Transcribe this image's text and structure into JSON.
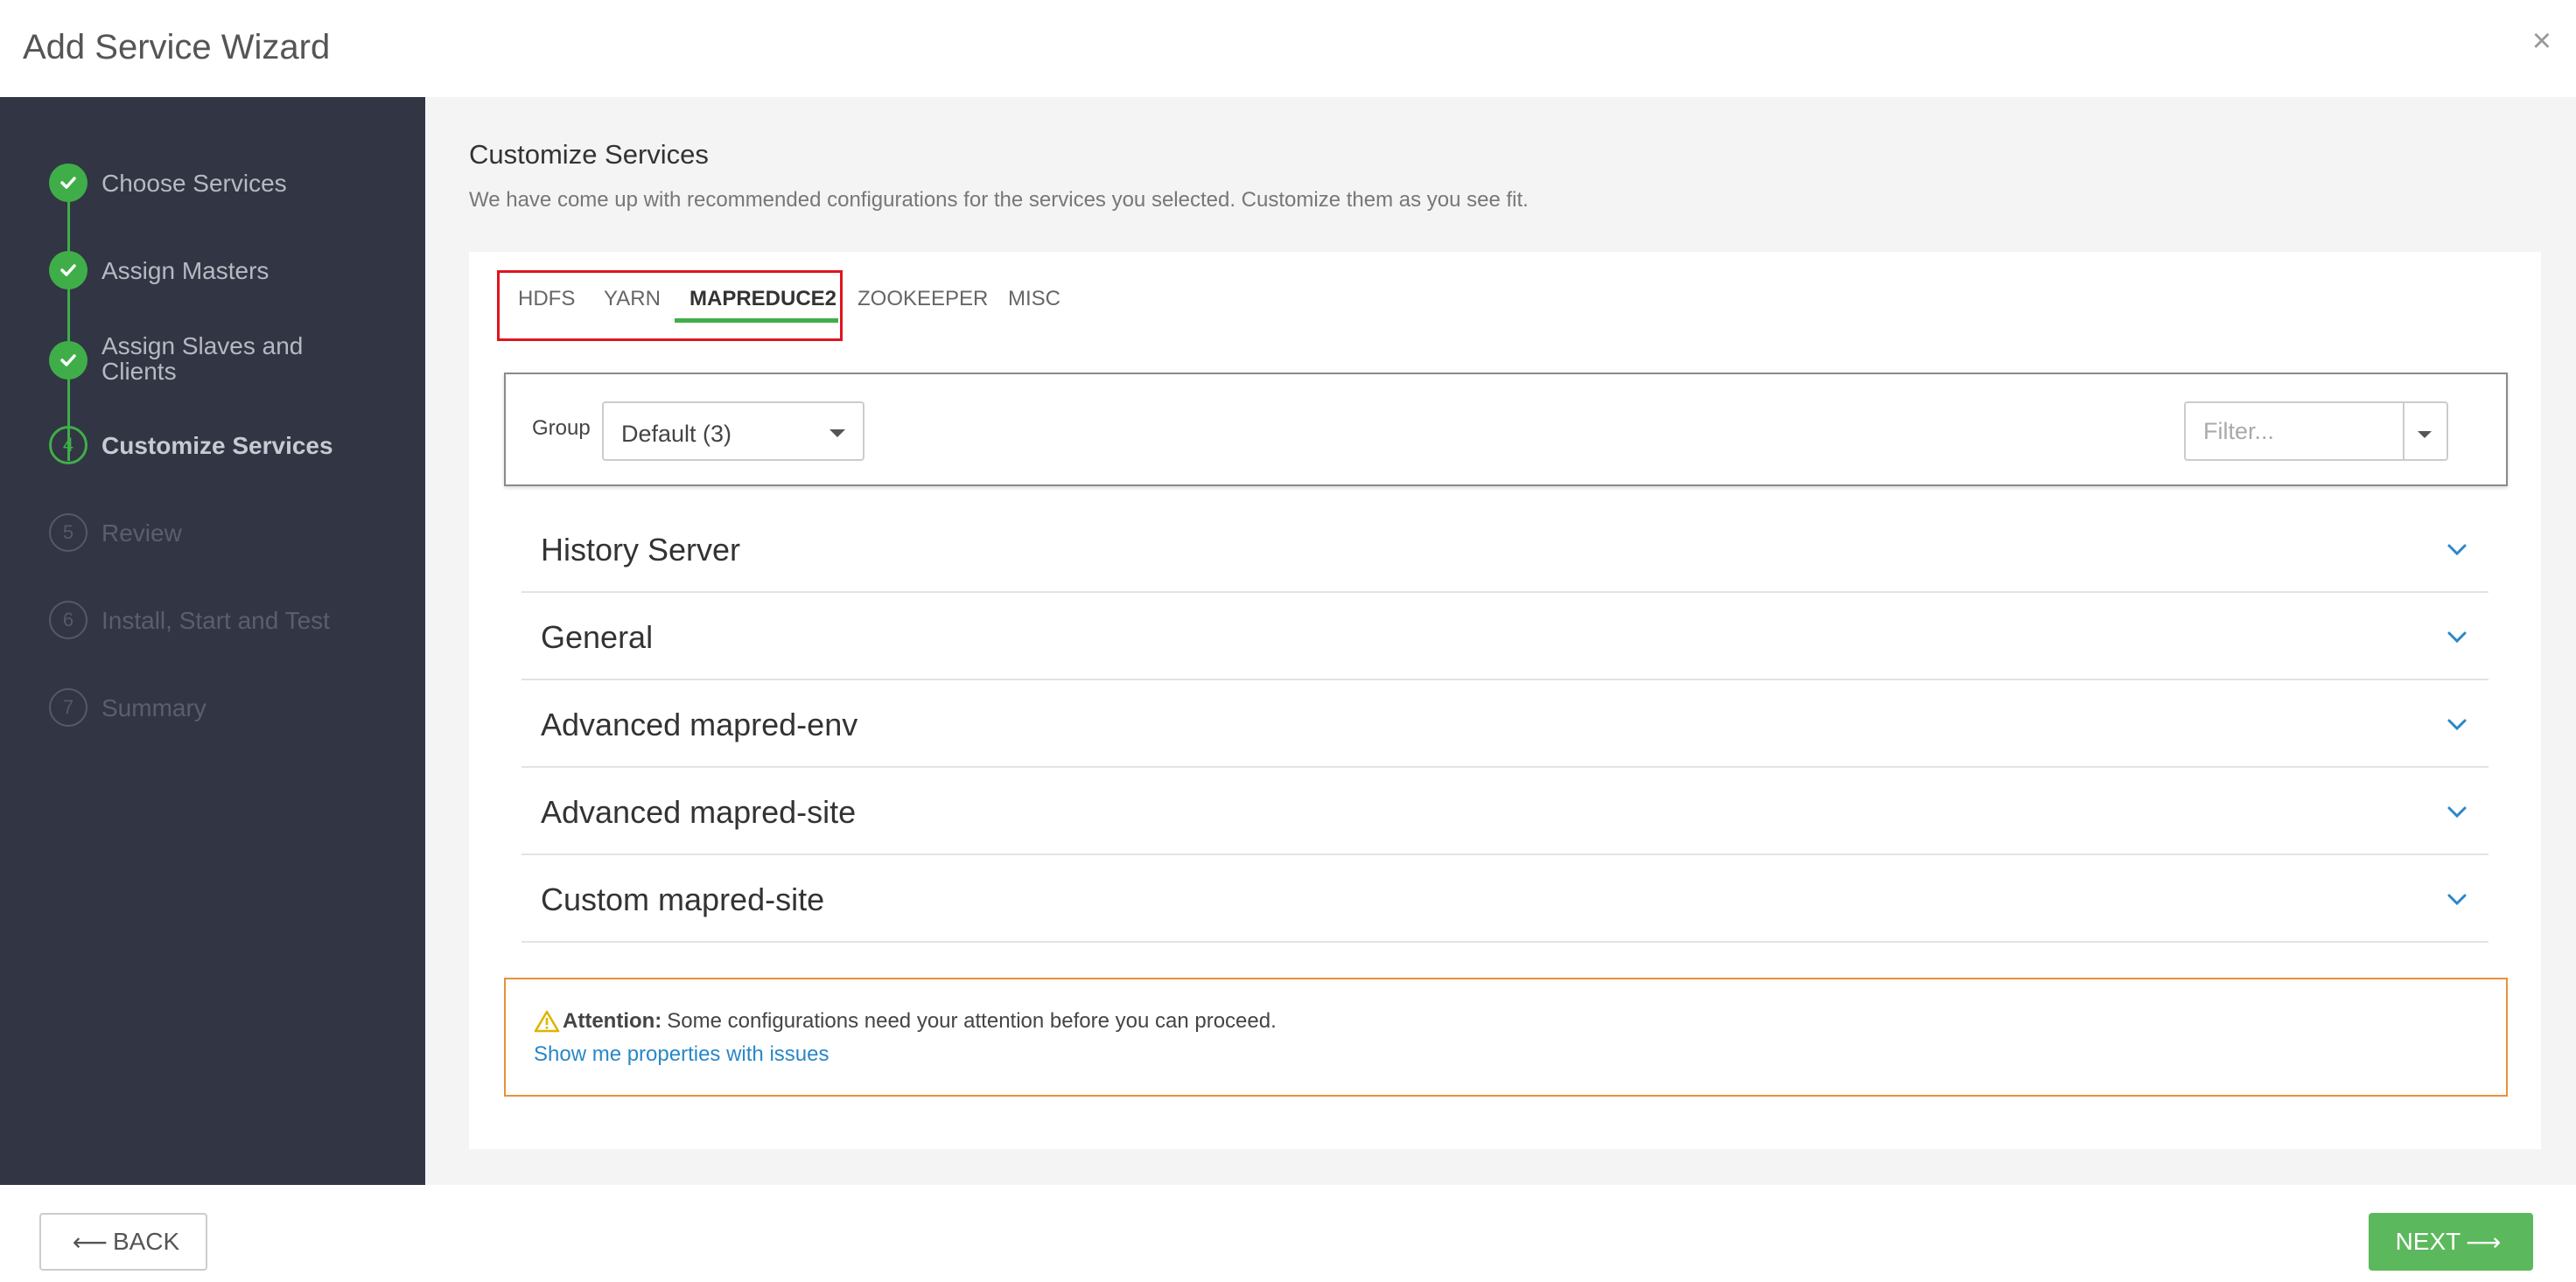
{
  "window": {
    "title": "Add Service Wizard",
    "close_symbol": "×"
  },
  "steps": [
    {
      "label": "Choose Services",
      "state": "done",
      "marker": ""
    },
    {
      "label": "Assign Masters",
      "state": "done",
      "marker": ""
    },
    {
      "label": "Assign Slaves and Clients",
      "state": "done",
      "marker": ""
    },
    {
      "label": "Customize Services",
      "state": "current",
      "marker": "4"
    },
    {
      "label": "Review",
      "state": "todo",
      "marker": "5"
    },
    {
      "label": "Install, Start and Test",
      "state": "todo",
      "marker": "6"
    },
    {
      "label": "Summary",
      "state": "todo",
      "marker": "7"
    }
  ],
  "main": {
    "title": "Customize Services",
    "subtitle": "We have come up with recommended configurations for the services you selected. Customize them as you see fit."
  },
  "tabs": [
    {
      "label": "HDFS",
      "active": false
    },
    {
      "label": "YARN",
      "active": false
    },
    {
      "label": "MAPREDUCE2",
      "active": true
    },
    {
      "label": "ZOOKEEPER",
      "active": false
    },
    {
      "label": "MISC",
      "active": false
    }
  ],
  "filterbar": {
    "group_label": "Group",
    "group_value": "Default (3)",
    "filter_placeholder": "Filter..."
  },
  "sections": [
    "History Server",
    "General",
    "Advanced mapred-env",
    "Advanced mapred-site",
    "Custom mapred-site"
  ],
  "alert": {
    "strong": "Attention:",
    "message": "Some configurations need your attention before you can proceed.",
    "link": "Show me properties with issues"
  },
  "footer": {
    "back_label": "BACK",
    "next_label": "NEXT",
    "back_arrow": "⟵",
    "next_arrow": "⟶"
  },
  "colors": {
    "sidebar_bg": "#323544",
    "accent_green": "#3fae49",
    "next_button": "#5cb85c",
    "alert_border": "#e6913a",
    "link_blue": "#2a87c8",
    "tab_highlight": "#e0141e"
  },
  "icons": {
    "step_done": "check-icon",
    "section_toggle": "chevron-down-icon",
    "alert": "warning-icon",
    "close": "close-icon"
  }
}
